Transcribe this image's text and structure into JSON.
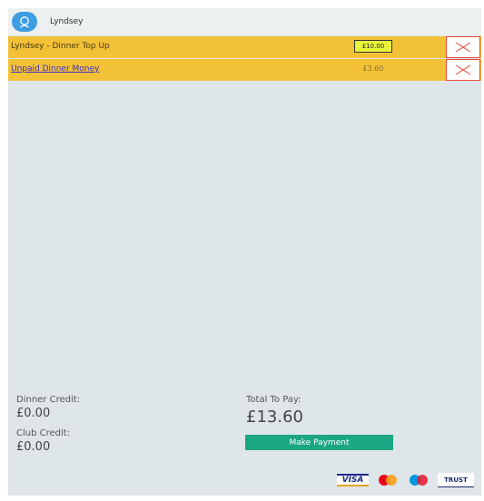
{
  "user": {
    "name": "Lyndsey",
    "icon": "user-search-icon"
  },
  "items": [
    {
      "label": "Lyndsey - Dinner Top Up",
      "amount": "£10.00",
      "editable": true,
      "link": false
    },
    {
      "label": "Unpaid Dinner Money",
      "amount": "£3.60",
      "editable": false,
      "link": true
    }
  ],
  "totals": {
    "dinner_credit_label": "Dinner Credit:",
    "dinner_credit_value": "£0.00",
    "club_credit_label": "Club Credit:",
    "club_credit_value": "£0.00",
    "total_label": "Total To Pay:",
    "total_value": "£13.60"
  },
  "actions": {
    "make_payment_label": "Make Payment"
  },
  "payment_logos": {
    "visa": "VISA",
    "trust": "TRUST"
  },
  "colors": {
    "row_bg": "#f2c136",
    "panel_bg": "#dfe6e9",
    "pay_button": "#1ba784",
    "remove_border": "#e74c3c",
    "avatar": "#3e9ce0"
  }
}
